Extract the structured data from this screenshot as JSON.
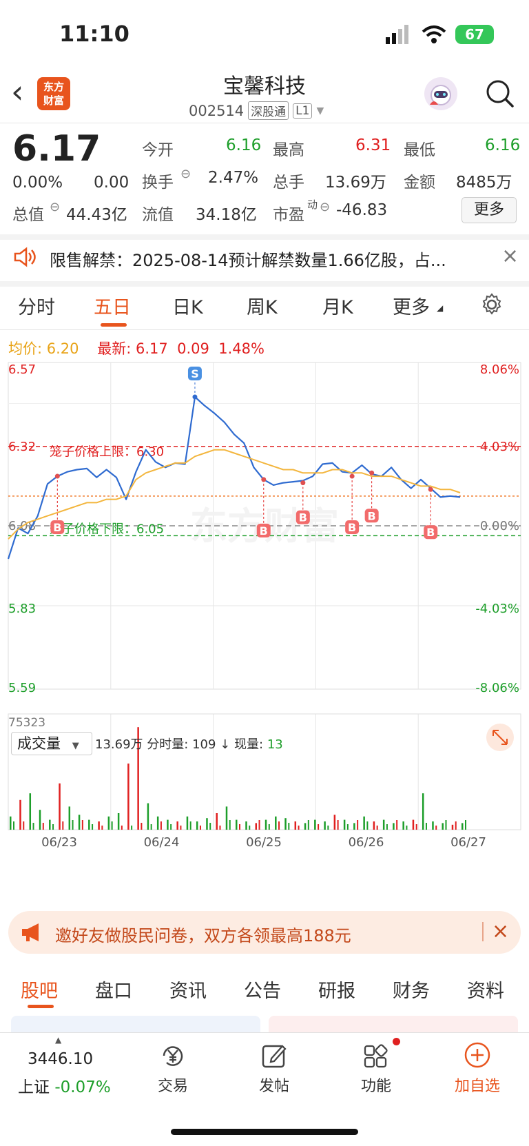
{
  "status": {
    "time": "11:10",
    "battery": "67"
  },
  "header": {
    "back": "‹",
    "logo": [
      "东方",
      "财富"
    ],
    "name": "宝馨科技",
    "code": "002514",
    "tag1": "深股通",
    "tag2": "L1"
  },
  "quote": {
    "price": "6.17",
    "change_pct": "0.00%",
    "change": "0.00",
    "open_label": "今开",
    "open": "6.16",
    "high_label": "最高",
    "high": "6.31",
    "low_label": "最低",
    "low": "6.16",
    "turnover_label": "换手",
    "turnover": "2.47%",
    "volume_label": "总手",
    "volume": "13.69万",
    "amount_label": "金额",
    "amount": "8485万",
    "mktcap_label": "总值",
    "mktcap": "44.43亿",
    "float_label": "流值",
    "float": "34.18亿",
    "pe_label": "市盈",
    "pe_sup": "动",
    "pe": "-46.83",
    "more": "更多"
  },
  "notice": {
    "text": "限售解禁：2025-08-14预计解禁数量1.66亿股，占...",
    "close": "×"
  },
  "tabs": [
    "分时",
    "五日",
    "日K",
    "周K",
    "月K",
    "更多"
  ],
  "legend": {
    "avg_label": "均价:",
    "avg": "6.20",
    "latest_label": "最新:",
    "latest": "6.17",
    "chg": "0.09",
    "chg_pct": "1.48%"
  },
  "chart_data": {
    "type": "line",
    "x_labels": [
      "06/23",
      "06/24",
      "06/25",
      "06/26",
      "06/27"
    ],
    "y_left": [
      "6.57",
      "6.32",
      "6.08",
      "5.83",
      "5.59"
    ],
    "y_right": [
      "8.06%",
      "4.03%",
      "0.00%",
      "-4.03%",
      "-8.06%"
    ],
    "ylim": [
      5.59,
      6.57
    ],
    "prev_close": 6.08,
    "upper_limit_label": "笼子价格上限：6.30",
    "upper_limit": 6.3,
    "lower_limit_label": "笼子价格下限：6.05",
    "lower_limit": 6.05,
    "current_price": 6.17,
    "watermark": "东方财富",
    "series": [
      {
        "name": "最新",
        "color": "#2f6bd0",
        "values": [
          5.97,
          6.07,
          6.06,
          6.12,
          6.2,
          6.23,
          6.25,
          6.24,
          6.25,
          6.23,
          6.26,
          6.22,
          6.16,
          6.25,
          6.3,
          6.27,
          6.26,
          6.28,
          6.26,
          6.47,
          6.45,
          6.41,
          6.39,
          6.36,
          6.34,
          6.25,
          6.22,
          6.21,
          6.2,
          6.21,
          6.22,
          6.24,
          6.26,
          6.27,
          6.25,
          6.23,
          6.26,
          6.24,
          6.24,
          6.25,
          6.22,
          6.2,
          6.21,
          6.19,
          6.17,
          6.18,
          6.16
        ]
      },
      {
        "name": "均价",
        "color": "#f3b63e",
        "values": [
          6.04,
          6.07,
          6.09,
          6.1,
          6.11,
          6.12,
          6.13,
          6.14,
          6.15,
          6.15,
          6.16,
          6.16,
          6.17,
          6.22,
          6.24,
          6.25,
          6.26,
          6.27,
          6.27,
          6.29,
          6.3,
          6.31,
          6.31,
          6.3,
          6.29,
          6.28,
          6.27,
          6.26,
          6.25,
          6.25,
          6.24,
          6.24,
          6.24,
          6.25,
          6.25,
          6.24,
          6.24,
          6.23,
          6.23,
          6.23,
          6.22,
          6.21,
          6.2,
          6.2,
          6.19,
          6.19,
          6.18
        ]
      }
    ],
    "markers": [
      {
        "type": "B",
        "x_index": 5,
        "y": 6.23
      },
      {
        "type": "S",
        "x_index": 19,
        "y": 6.47
      },
      {
        "type": "B",
        "x_index": 26,
        "y": 6.22
      },
      {
        "type": "B",
        "x_index": 30,
        "y": 6.21
      },
      {
        "type": "B",
        "x_index": 35,
        "y": 6.23
      },
      {
        "type": "B",
        "x_index": 37,
        "y": 6.24
      },
      {
        "type": "B",
        "x_index": 43,
        "y": 6.19
      }
    ],
    "volume": {
      "max_label": "75323",
      "spikes": [
        8,
        18,
        22,
        12,
        6,
        28,
        14,
        9,
        6,
        5,
        8,
        10,
        40,
        62,
        16,
        8,
        6,
        5,
        8,
        5,
        7,
        10,
        14,
        6,
        5,
        4,
        6,
        8,
        7,
        5,
        4,
        6,
        5,
        9,
        6,
        4,
        8,
        5,
        6,
        4,
        5,
        6,
        22,
        5,
        4,
        3,
        4
      ]
    }
  },
  "volume_bar": {
    "select": "成交量",
    "total": "13.69万",
    "period_label": "分时量:",
    "period": "109",
    "arrow": "↓",
    "now_label": "现量:",
    "now": "13"
  },
  "promo": {
    "text": "邀好友做股民问卷，双方各领最高188元",
    "close": "×"
  },
  "bottom_tabs": [
    "股吧",
    "盘口",
    "资讯",
    "公告",
    "研报",
    "财务",
    "资料"
  ],
  "bottom_nav": {
    "index_value": "3446.10",
    "index_name": "上证",
    "index_change": "-0.07%",
    "trade": "交易",
    "post": "发帖",
    "func": "功能",
    "add": "加自选"
  }
}
